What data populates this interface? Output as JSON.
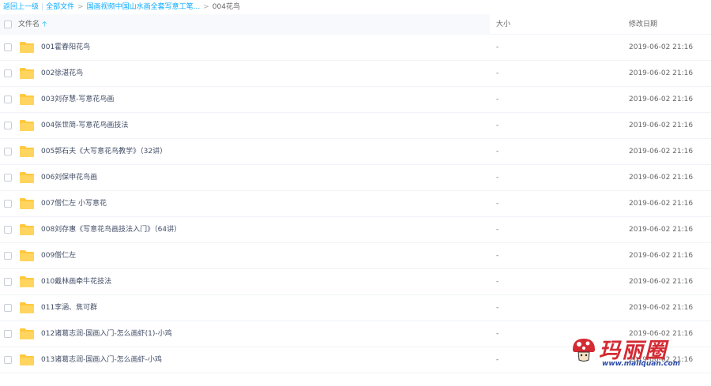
{
  "breadcrumb": {
    "back_label": "返回上一级",
    "all_files_label": "全部文件",
    "parent_label": "国画视频中国山水画全套写意工笔...",
    "current_label": "004花鸟"
  },
  "header": {
    "name_label": "文件名",
    "size_label": "大小",
    "date_label": "修改日期",
    "sort_icon": "arrow-up-icon"
  },
  "files": [
    {
      "name": "001霍春阳花鸟",
      "size": "-",
      "date": "2019-06-02 21:16"
    },
    {
      "name": "002徐湛花鸟",
      "size": "-",
      "date": "2019-06-02 21:16"
    },
    {
      "name": "003刘存慧-写意花鸟画",
      "size": "-",
      "date": "2019-06-02 21:16"
    },
    {
      "name": "004张世简-写意花鸟画技法",
      "size": "-",
      "date": "2019-06-02 21:16"
    },
    {
      "name": "005郭石夫《大写意花鸟教学》（32讲）",
      "size": "-",
      "date": "2019-06-02 21:16"
    },
    {
      "name": "006刘保申花鸟画",
      "size": "-",
      "date": "2019-06-02 21:16"
    },
    {
      "name": "007僧仁左 小写意花",
      "size": "-",
      "date": "2019-06-02 21:16"
    },
    {
      "name": "008刘存惠《写意花鸟画技法入门》（64讲）",
      "size": "-",
      "date": "2019-06-02 21:16"
    },
    {
      "name": "009僧仁左",
      "size": "-",
      "date": "2019-06-02 21:16"
    },
    {
      "name": "010戴林画牵牛花技法",
      "size": "-",
      "date": "2019-06-02 21:16"
    },
    {
      "name": "011李涵、焦可群",
      "size": "-",
      "date": "2019-06-02 21:16"
    },
    {
      "name": "012诸葛志润-国画入门-怎么画虾(1)-小鸡",
      "size": "-",
      "date": "2019-06-02 21:16"
    },
    {
      "name": "013诸葛志润-国画入门-怎么画虾-小鸡",
      "size": "-",
      "date": "2019-06-02 21:16"
    }
  ],
  "watermark": {
    "text": "玛丽圈",
    "url": "www.maliquan.com"
  },
  "colors": {
    "accent": "#09aaff",
    "folder": "#ffd55f",
    "folder_tab": "#ffc83d",
    "text": "#424e67",
    "watermark_red": "#d42a33"
  }
}
